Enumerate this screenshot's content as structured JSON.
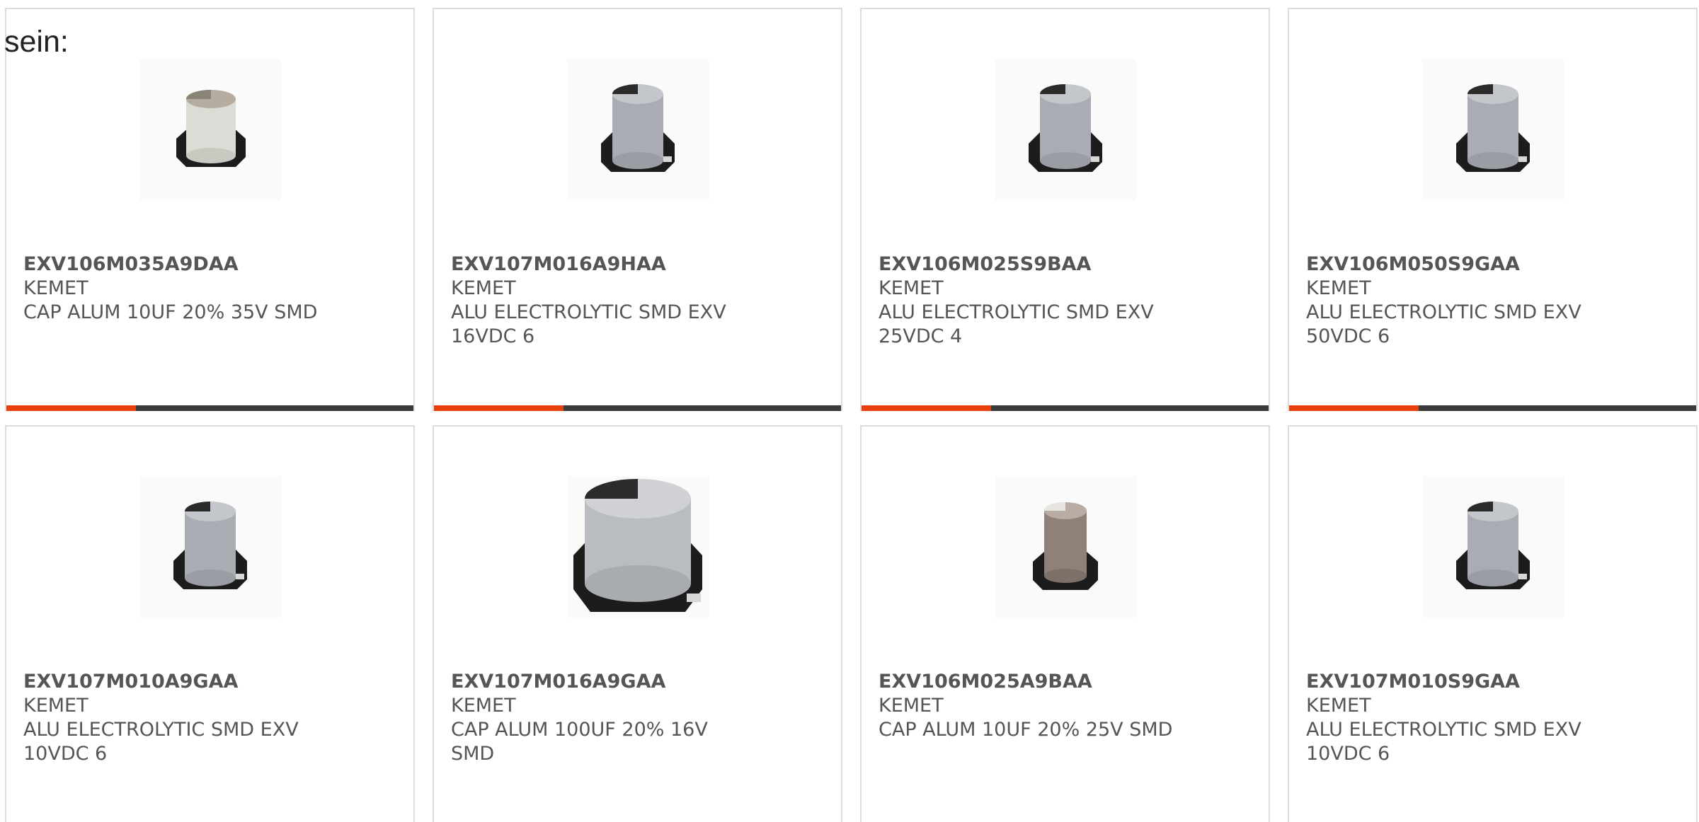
{
  "intro_text": "sein:",
  "products": [
    {
      "part_number": "EXV106M035A9DAA",
      "manufacturer": "KEMET",
      "description": "CAP ALUM 10UF 20% 35V SMD",
      "image_icon": "white-smd-capacitor-icon"
    },
    {
      "part_number": "EXV107M016A9HAA",
      "manufacturer": "KEMET",
      "description": "ALU ELECTROLYTIC SMD EXV 16VDC 6",
      "image_icon": "smd-capacitor-icon"
    },
    {
      "part_number": "EXV106M025S9BAA",
      "manufacturer": "KEMET",
      "description": "ALU ELECTROLYTIC SMD EXV 25VDC 4",
      "image_icon": "smd-capacitor-icon"
    },
    {
      "part_number": "EXV106M050S9GAA",
      "manufacturer": "KEMET",
      "description": "ALU ELECTROLYTIC SMD EXV 50VDC 6",
      "image_icon": "smd-capacitor-icon"
    },
    {
      "part_number": "EXV107M010A9GAA",
      "manufacturer": "KEMET",
      "description": "ALU ELECTROLYTIC SMD EXV 10VDC 6",
      "image_icon": "smd-capacitor-icon"
    },
    {
      "part_number": "EXV107M016A9GAA",
      "manufacturer": "KEMET",
      "description": "CAP ALUM 100UF 20% 16V SMD",
      "image_icon": "large-smd-capacitor-icon"
    },
    {
      "part_number": "EXV106M025A9BAA",
      "manufacturer": "KEMET",
      "description": "CAP ALUM 10UF 20% 25V SMD",
      "image_icon": "brown-smd-capacitor-icon"
    },
    {
      "part_number": "EXV107M010S9GAA",
      "manufacturer": "KEMET",
      "description": "ALU ELECTROLYTIC SMD EXV 10VDC 6",
      "image_icon": "smd-capacitor-icon"
    }
  ],
  "colors": {
    "accent": "#e8400c",
    "bar_dark": "#3a3a3a",
    "card_border": "#dcdcdc",
    "text": "#555555"
  }
}
